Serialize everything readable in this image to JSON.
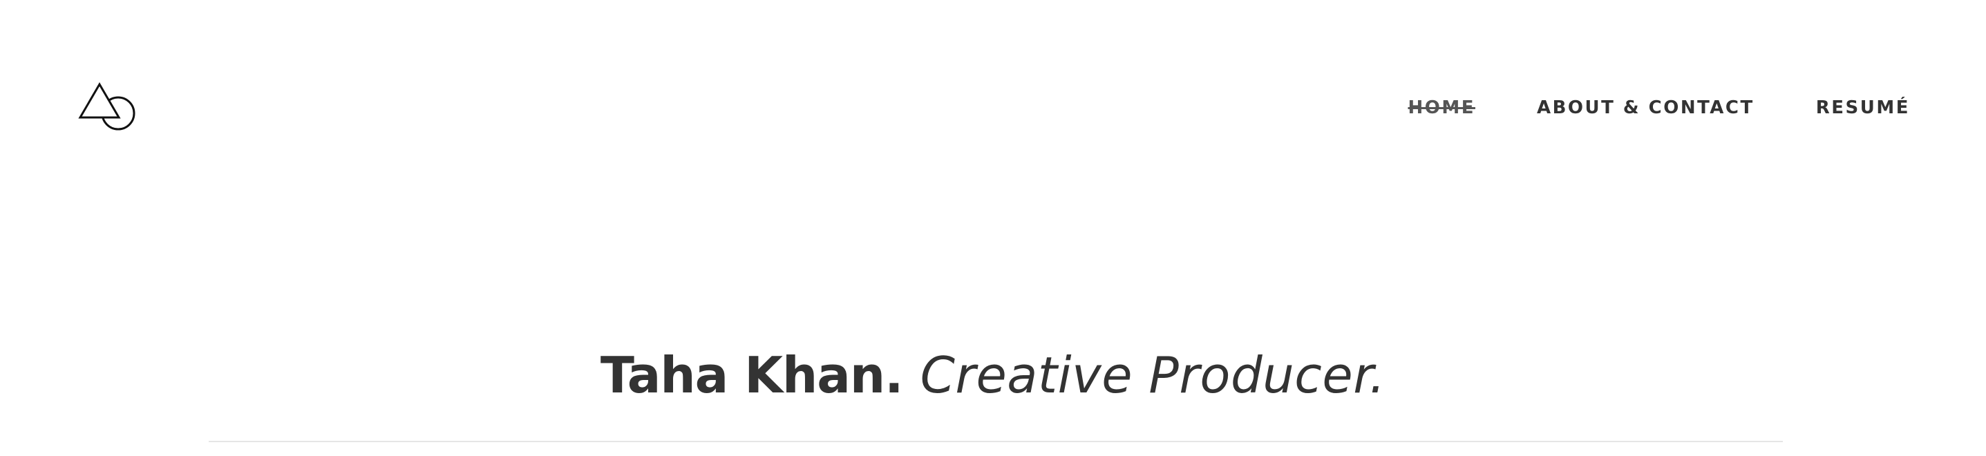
{
  "header": {
    "logo": {
      "icon": "triangle-circle-logo-icon",
      "stroke_color": "#111111"
    },
    "nav": {
      "items": [
        {
          "label": "HOME",
          "active": true
        },
        {
          "label": "ABOUT & CONTACT",
          "active": false
        },
        {
          "label": "RESUMÉ",
          "active": false
        }
      ]
    }
  },
  "hero": {
    "name": "Taha Khan.",
    "role": "Creative Producer."
  },
  "colors": {
    "text": "#333333",
    "active_nav": "#555555",
    "background": "#ffffff",
    "divider": "#e6e6e6"
  }
}
